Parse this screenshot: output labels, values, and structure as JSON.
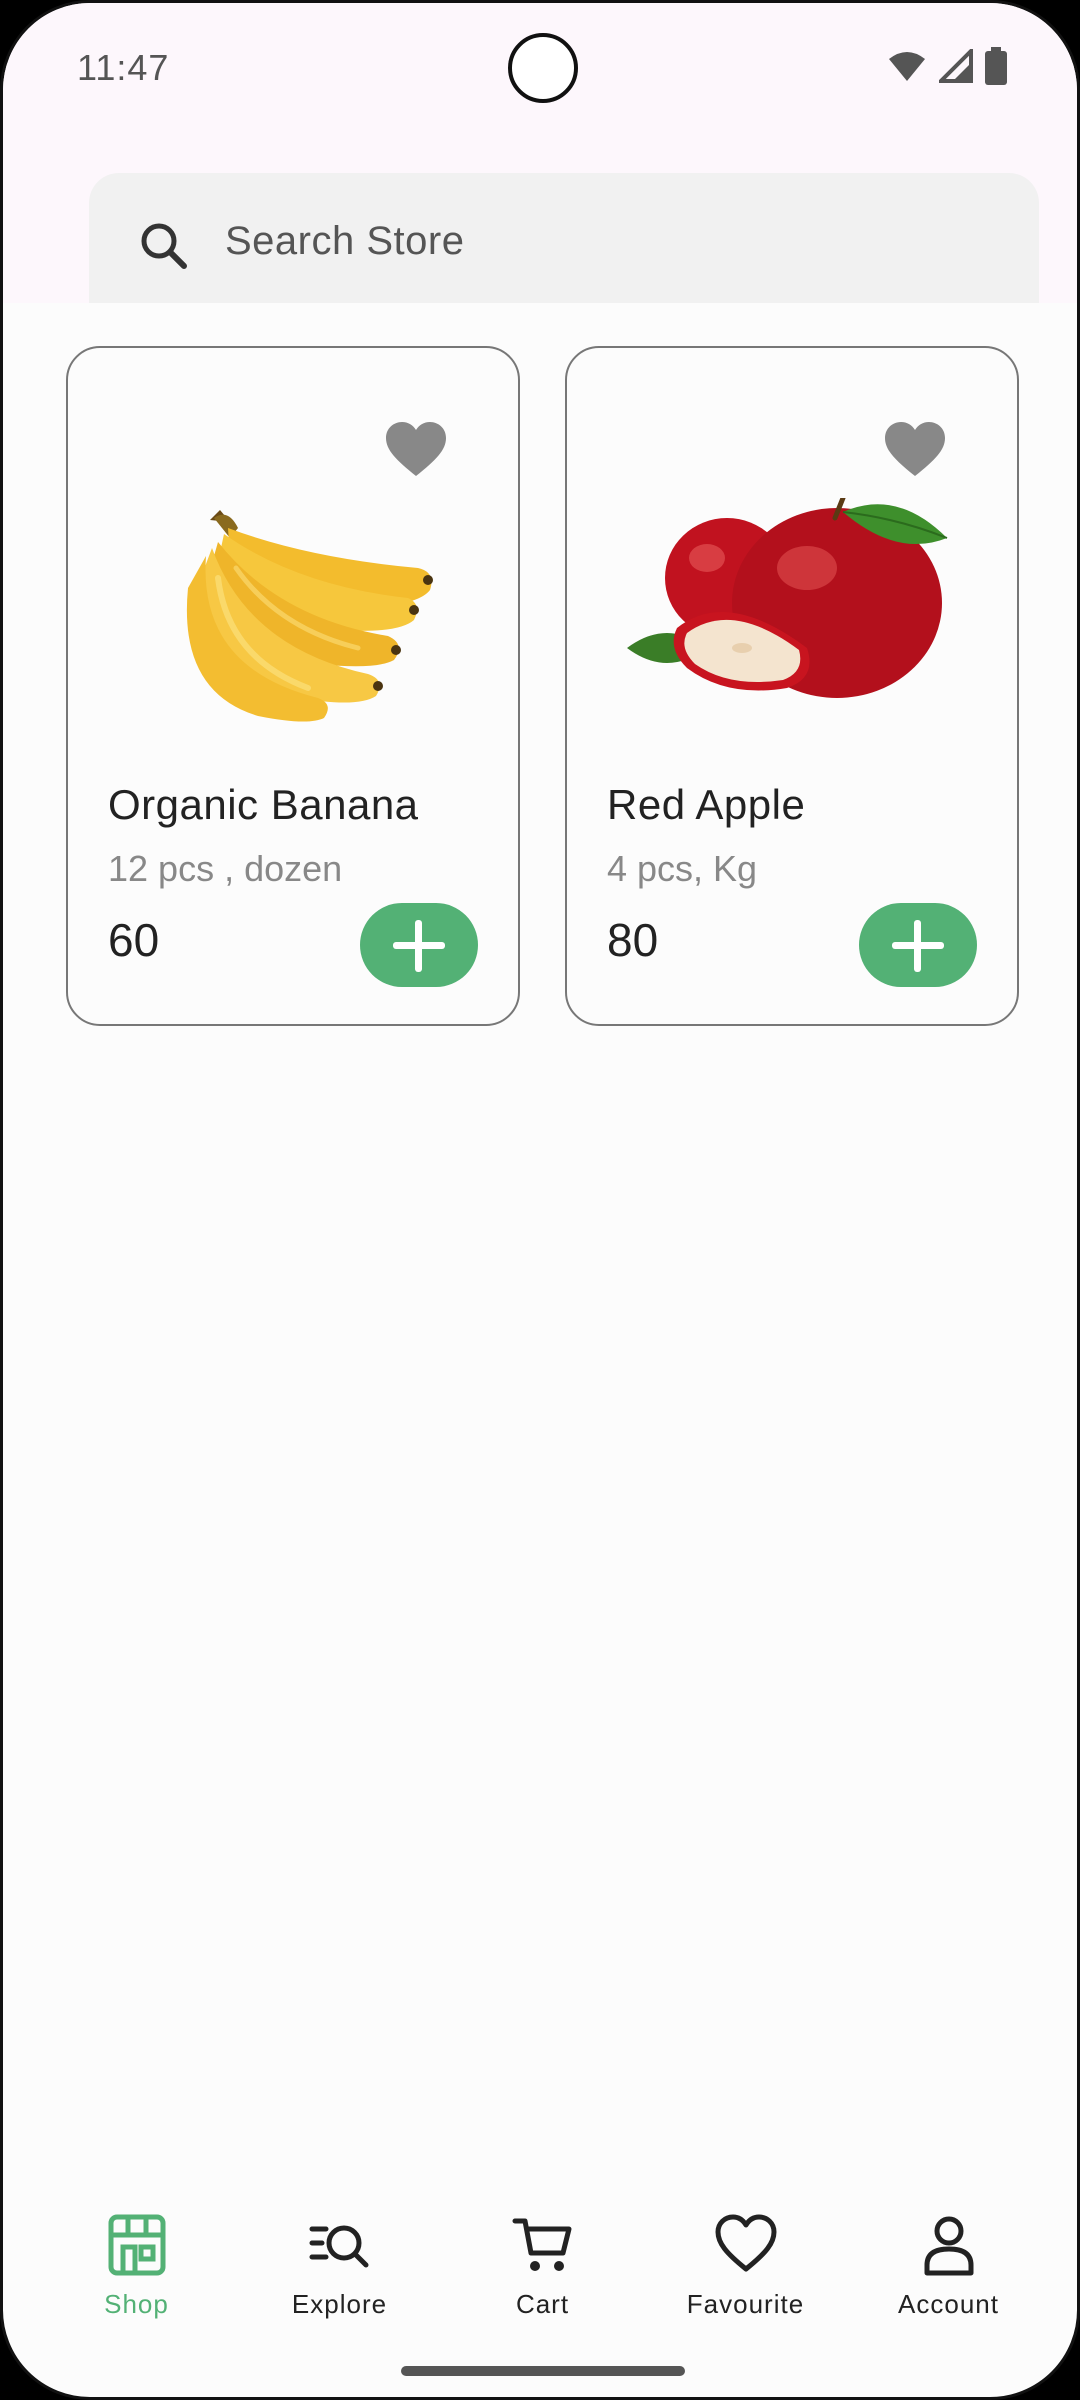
{
  "status_bar": {
    "time": "11:47",
    "icons": [
      "wifi-icon",
      "signal-icon",
      "battery-icon"
    ]
  },
  "search": {
    "placeholder": "Search Store",
    "icon": "search-icon"
  },
  "products": [
    {
      "name": "Organic Banana",
      "quantity": "12 pcs , dozen",
      "price": "60",
      "image": "banana-image",
      "favourite_icon": "heart-icon"
    },
    {
      "name": "Red Apple",
      "quantity": "4 pcs, Kg",
      "price": "80",
      "image": "apple-image",
      "favourite_icon": "heart-icon"
    }
  ],
  "bottom_nav": {
    "items": [
      {
        "label": "Shop",
        "icon": "store-icon",
        "active": true
      },
      {
        "label": "Explore",
        "icon": "explore-search-icon",
        "active": false
      },
      {
        "label": "Cart",
        "icon": "cart-icon",
        "active": false
      },
      {
        "label": "Favourite",
        "icon": "heart-outline-icon",
        "active": false
      },
      {
        "label": "Account",
        "icon": "account-icon",
        "active": false
      }
    ]
  },
  "colors": {
    "accent": "#53b175",
    "card_border": "#777777",
    "favourite_heart": "#888888"
  }
}
